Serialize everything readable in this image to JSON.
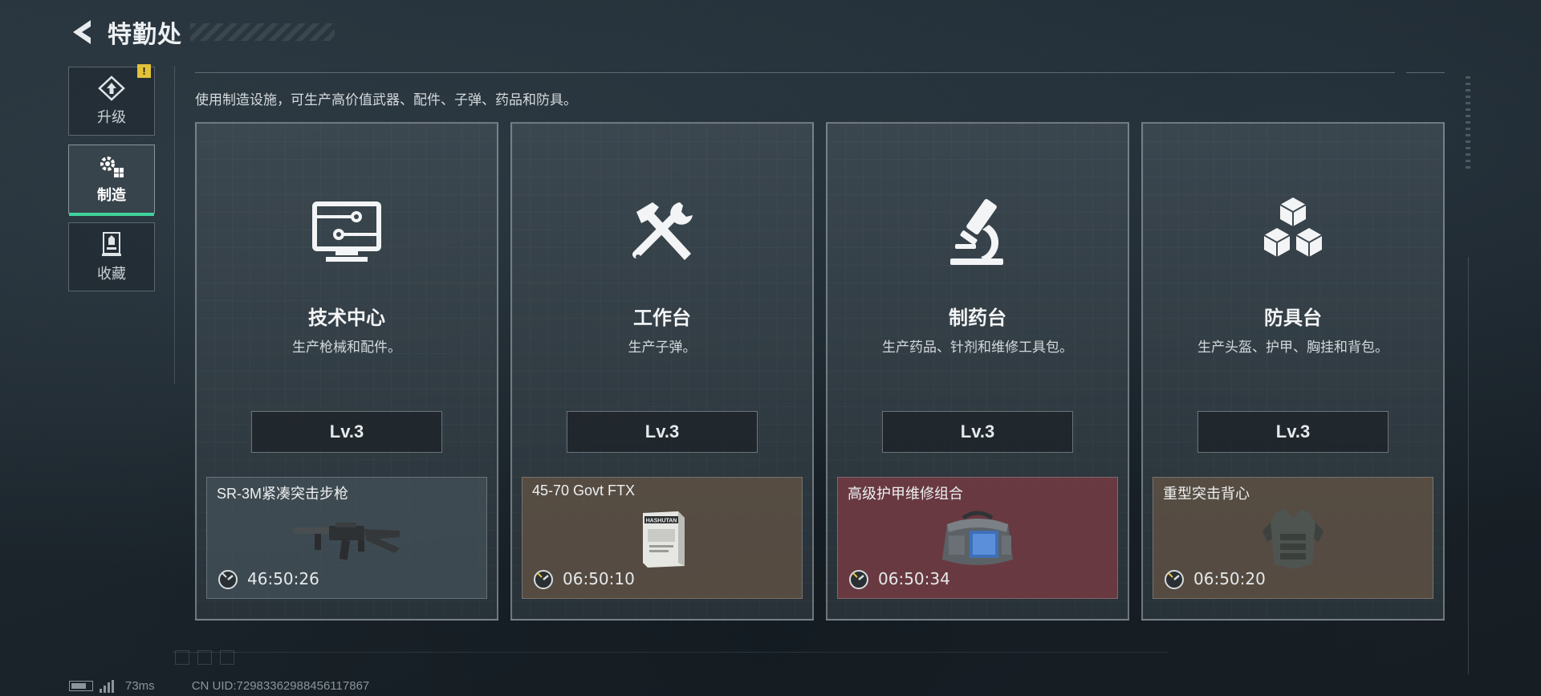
{
  "header": {
    "title": "特勤处"
  },
  "sidebar": {
    "items": [
      {
        "label": "升级",
        "icon": "upgrade-icon",
        "badge": "!"
      },
      {
        "label": "制造",
        "icon": "gears-icon",
        "active": true
      },
      {
        "label": "收藏",
        "icon": "collection-icon"
      }
    ]
  },
  "description": "使用制造设施，可生产高价值武器、配件、子弹、药品和防具。",
  "cards": [
    {
      "title": "技术中心",
      "subtitle": "生产枪械和配件。",
      "icon": "monitor-icon",
      "level": "Lv.3",
      "craft": {
        "name": "SR-3M紧凑突击步枪",
        "timer": "46:50:26",
        "item_icon": "rifle-icon",
        "tint": "grey"
      }
    },
    {
      "title": "工作台",
      "subtitle": "生产子弹。",
      "icon": "hammer-wrench-icon",
      "level": "Lv.3",
      "craft": {
        "name": "45-70 Govt FTX",
        "timer": "06:50:10",
        "item_icon": "ammo-box-icon",
        "box_text": "HASHUTAN",
        "tint": "tan"
      }
    },
    {
      "title": "制药台",
      "subtitle": "生产药品、针剂和维修工具包。",
      "icon": "microscope-icon",
      "level": "Lv.3",
      "craft": {
        "name": "高级护甲维修组合",
        "timer": "06:50:34",
        "item_icon": "repair-bag-icon",
        "tint": "red"
      }
    },
    {
      "title": "防具台",
      "subtitle": "生产头盔、护甲、胸挂和背包。",
      "icon": "cubes-icon",
      "level": "Lv.3",
      "craft": {
        "name": "重型突击背心",
        "timer": "06:50:20",
        "item_icon": "vest-icon",
        "tint": "tan"
      }
    }
  ],
  "footer": {
    "ping": "73ms",
    "uid": "CN UID:7298336298845611786​7"
  },
  "colors": {
    "accent_green": "#3fd39a",
    "warning_yellow": "#e2c23a",
    "tint_grey": "#46525a",
    "tint_tan": "#625244",
    "tint_red": "#763a42"
  }
}
